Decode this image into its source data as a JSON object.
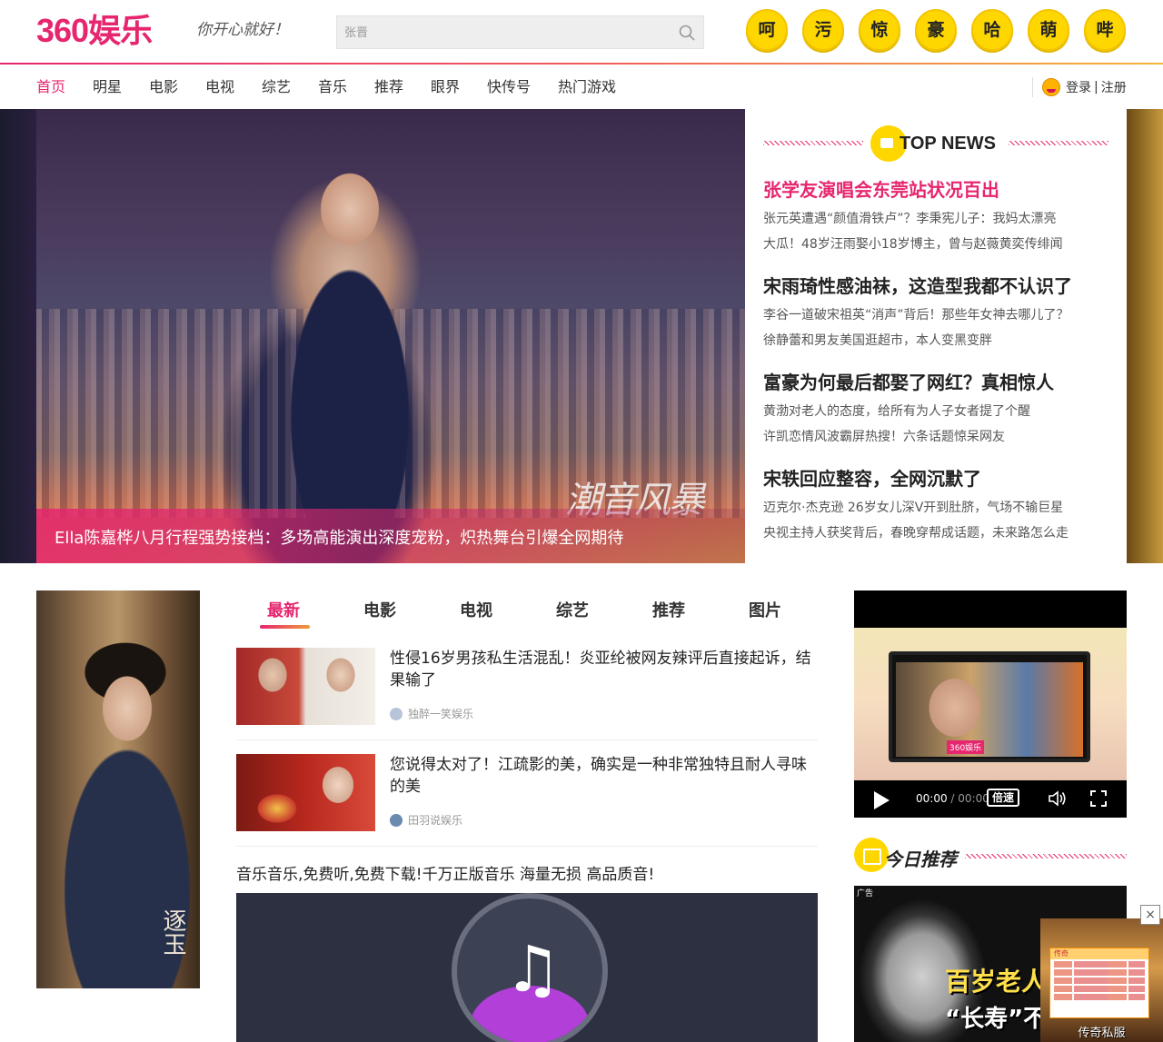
{
  "header": {
    "logo": "360娱乐",
    "slogan": "你开心就好！",
    "search": {
      "placeholder": "张晋"
    },
    "emoji_tags": [
      "呵",
      "污",
      "惊",
      "豪",
      "哈",
      "萌",
      "哔"
    ]
  },
  "nav": {
    "items": [
      "首页",
      "明星",
      "电影",
      "电视",
      "综艺",
      "音乐",
      "推荐",
      "眼界",
      "快传号",
      "热门游戏"
    ],
    "active": "首页",
    "login": "登录",
    "divider": "|",
    "register": "注册"
  },
  "hero": {
    "caption": "Ella陈嘉桦八月行程强势接档：多场高能演出深度宠粉，炽热舞台引爆全网期待",
    "watermark": "潮音风暴"
  },
  "top_news": {
    "title": "TOP NEWS",
    "blocks": [
      {
        "headline": "张学友演唱会东莞站状况百出",
        "hot": true,
        "subs": [
          "张元英遭遇“颜值滑铁卢”？李秉宪儿子：我妈太漂亮",
          "大瓜！48岁汪雨娶小18岁博主，曾与赵薇黄奕传绯闻"
        ]
      },
      {
        "headline": "宋雨琦性感油袜，这造型我都不认识了",
        "hot": false,
        "subs": [
          "李谷一道破宋祖英“消声”背后！那些年女神去哪儿了？",
          "徐静蕾和男友美国逛超市，本人变黑变胖"
        ]
      },
      {
        "headline": "富豪为何最后都娶了网红？真相惊人",
        "hot": false,
        "subs": [
          "黄渤对老人的态度，给所有为人子女者提了个醒",
          "许凯恋情风波霸屏热搜！六条话题惊呆网友"
        ]
      },
      {
        "headline": "宋轶回应整容，全网沉默了",
        "hot": false,
        "subs": [
          "迈克尔·杰克逊 26岁女儿深V开到肚脐，气场不输巨星",
          "央视主持人获奖背后，春晚穿帮成话题，未来路怎么走"
        ]
      }
    ]
  },
  "poster": {
    "caption": "逐玉"
  },
  "tabs": {
    "items": [
      "最新",
      "电影",
      "电视",
      "综艺",
      "推荐",
      "图片"
    ],
    "active": "最新"
  },
  "news": [
    {
      "title": "性侵16岁男孩私生活混乱！炎亚纶被网友辣评后直接起诉，结果输了",
      "source": "独醉一笑娱乐"
    },
    {
      "title": "您说得太对了！江疏影的美，确实是一种非常独特且耐人寻味的美",
      "source": "田羽说娱乐"
    }
  ],
  "ad": {
    "title": "音乐音乐,免费听,免费下载!千万正版音乐 海量无损 高品质音!"
  },
  "video": {
    "badge": "360娱乐",
    "time_current": "00:00",
    "time_sep": "/",
    "time_total": "00:00",
    "speed_label": "倍速"
  },
  "recommend": {
    "title": "今日推荐",
    "ad_label": "广告",
    "ad_line1": "百岁老人自",
    "ad_line2": "“长寿”不靠"
  },
  "float_ad": {
    "close": "×",
    "window_title": "传奇",
    "label": "传奇私服"
  },
  "colors": {
    "accent": "#e6266f",
    "emoji_yellow": "#ffd700",
    "text": "#222222"
  }
}
